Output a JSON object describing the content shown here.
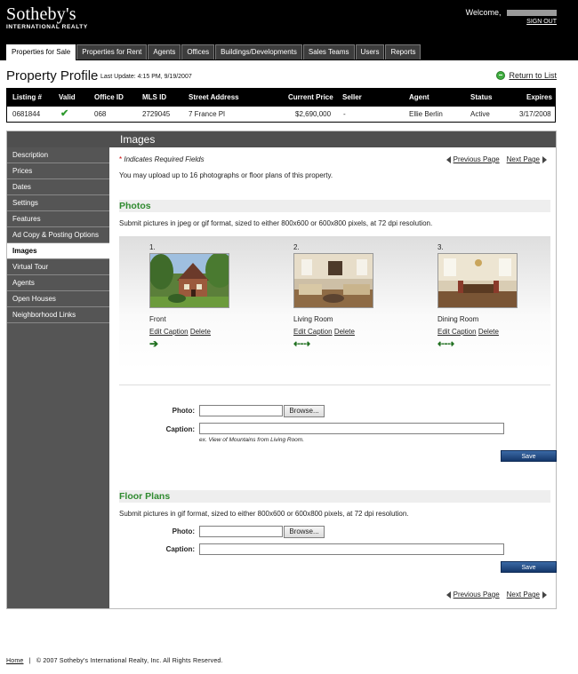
{
  "header": {
    "logo_main": "Sotheby's",
    "logo_sub": "INTERNATIONAL REALTY",
    "welcome_label": "Welcome,",
    "sign_out": "SIGN OUT"
  },
  "tabs": [
    {
      "label": "Properties for Sale",
      "active": true
    },
    {
      "label": "Properties for Rent"
    },
    {
      "label": "Agents"
    },
    {
      "label": "Offices"
    },
    {
      "label": "Buildings/Developments"
    },
    {
      "label": "Sales Teams"
    },
    {
      "label": "Users"
    },
    {
      "label": "Reports"
    }
  ],
  "page": {
    "title": "Property Profile",
    "last_update": "Last Update: 4:15 PM, 9/19/2007",
    "return_link": "Return to List"
  },
  "listing_table": {
    "headers": [
      "Listing #",
      "Valid",
      "Office ID",
      "MLS ID",
      "Street Address",
      "Current Price",
      "Seller",
      "Agent",
      "Status",
      "Expires"
    ],
    "row": {
      "listing": "0681844",
      "valid_icon": "checkmark-icon",
      "office_id": "068",
      "mls_id": "2729045",
      "street": "7 France Pl",
      "price": "$2,690,000",
      "seller": "-",
      "agent": "Ellie Berlin",
      "status": "Active",
      "expires": "3/17/2008"
    }
  },
  "sidebar": {
    "items": [
      {
        "label": "Description"
      },
      {
        "label": "Prices"
      },
      {
        "label": "Dates"
      },
      {
        "label": "Settings"
      },
      {
        "label": "Features"
      },
      {
        "label": "Ad Copy & Posting Options"
      },
      {
        "label": "Images",
        "active": true
      },
      {
        "label": "Virtual Tour"
      },
      {
        "label": "Agents"
      },
      {
        "label": "Open Houses"
      },
      {
        "label": "Neighborhood Links"
      }
    ]
  },
  "images_section": {
    "title": "Images",
    "required_note": "Indicates Required Fields",
    "required_star": "*",
    "previous_page": "Previous Page",
    "next_page": "Next Page",
    "upload_info": "You may upload up to 16 photographs or floor plans of this property."
  },
  "photos": {
    "heading": "Photos",
    "instructions": "Submit pictures in jpeg or gif format, sized to either 800x600 or 600x800 pixels, at 72 dpi resolution.",
    "items": [
      {
        "num": "1.",
        "caption": "Front",
        "edit": "Edit Caption",
        "delete": "Delete",
        "arrows": "➔"
      },
      {
        "num": "2.",
        "caption": "Living Room",
        "edit": "Edit Caption",
        "delete": "Delete",
        "arrows": "⇠⇢"
      },
      {
        "num": "3.",
        "caption": "Dining Room",
        "edit": "Edit Caption",
        "delete": "Delete",
        "arrows": "⇠⇢"
      }
    ],
    "form": {
      "photo_label": "Photo:",
      "browse": "Browse...",
      "caption_label": "Caption:",
      "caption_hint": "ex. View of Mountains from Living Room.",
      "save": "Save"
    }
  },
  "floor_plans": {
    "heading": "Floor Plans",
    "instructions": "Submit pictures in gif format, sized to either 800x600 or 600x800 pixels, at 72 dpi resolution.",
    "form": {
      "photo_label": "Photo:",
      "browse": "Browse...",
      "caption_label": "Caption:",
      "save": "Save"
    }
  },
  "footer": {
    "home": "Home",
    "separator": "|",
    "copyright": "© 2007 Sotheby's International Realty, Inc. All Rights Reserved."
  }
}
